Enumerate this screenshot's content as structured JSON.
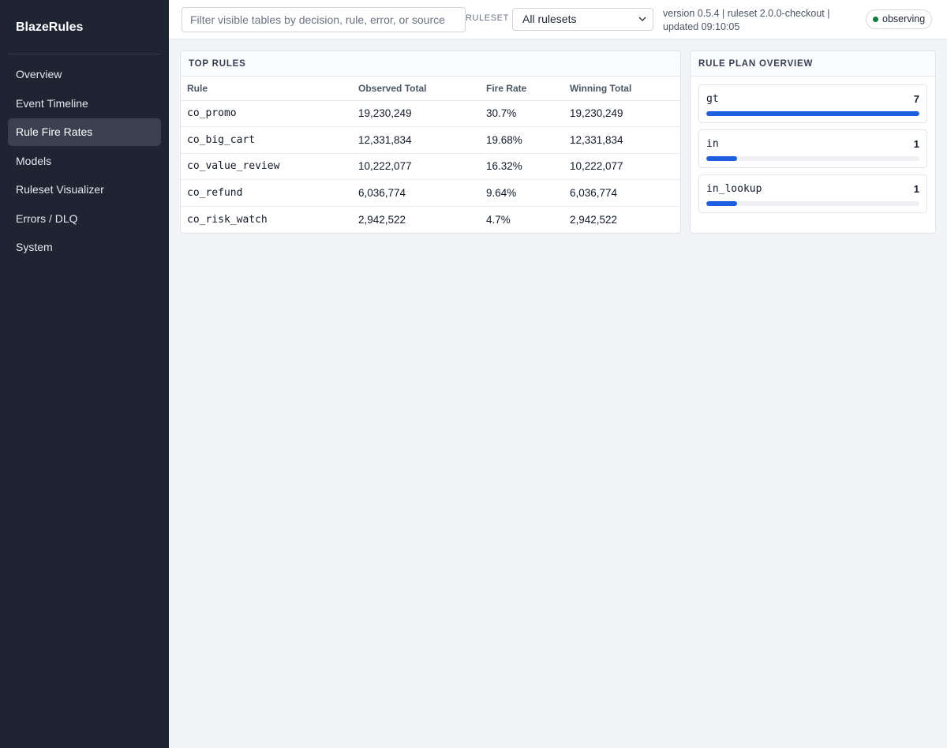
{
  "app": {
    "name": "BlazeRules"
  },
  "nav": [
    {
      "label": "Overview",
      "active": false
    },
    {
      "label": "Event Timeline",
      "active": false
    },
    {
      "label": "Rule Fire Rates",
      "active": true
    },
    {
      "label": "Models",
      "active": false
    },
    {
      "label": "Ruleset Visualizer",
      "active": false
    },
    {
      "label": "Errors / DLQ",
      "active": false
    },
    {
      "label": "System",
      "active": false
    }
  ],
  "topbar": {
    "search_placeholder": "Filter visible tables by decision, rule, error, or source",
    "search_value": "",
    "ruleset_label": "RULESET",
    "ruleset_selected": "All rulesets",
    "version_text": "version 0.5.4 | ruleset 2.0.0-checkout | updated 09:10:05",
    "status": "observing",
    "status_color": "#0f7a3d"
  },
  "top_rules": {
    "title": "TOP RULES",
    "columns": [
      "Rule",
      "Observed Total",
      "Fire Rate",
      "Winning Total"
    ],
    "rows": [
      [
        "co_promo",
        "19,230,249",
        "30.7%",
        "19,230,249"
      ],
      [
        "co_big_cart",
        "12,331,834",
        "19.68%",
        "12,331,834"
      ],
      [
        "co_value_review",
        "10,222,077",
        "16.32%",
        "10,222,077"
      ],
      [
        "co_refund",
        "6,036,774",
        "9.64%",
        "6,036,774"
      ],
      [
        "co_risk_watch",
        "2,942,522",
        "4.7%",
        "2,942,522"
      ]
    ]
  },
  "rule_plan": {
    "title": "RULE PLAN OVERVIEW",
    "bar_color": "#1d5fe0",
    "items": [
      {
        "name": "gt",
        "count": "7",
        "fraction": 1.0
      },
      {
        "name": "in",
        "count": "1",
        "fraction": 0.143
      },
      {
        "name": "in_lookup",
        "count": "1",
        "fraction": 0.143
      }
    ]
  }
}
